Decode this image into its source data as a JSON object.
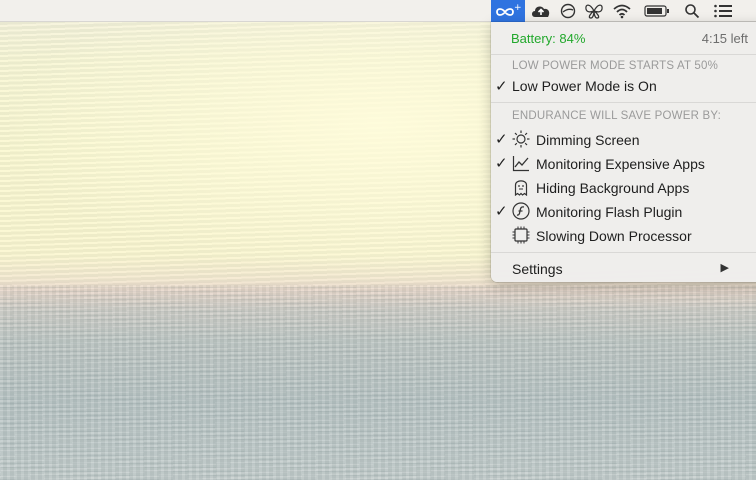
{
  "menubar": {
    "icons": [
      "endurance-icon",
      "cloud-upload-icon",
      "circle-status-icon",
      "butterfly-icon",
      "wifi-icon",
      "battery-icon",
      "spotlight-search-icon",
      "notification-list-icon"
    ]
  },
  "menu": {
    "battery_label": "Battery: 84%",
    "time_left": "4:15 left",
    "battery_color": "#22a82c",
    "low_power_header": "LOW POWER MODE STARTS AT 50%",
    "low_power_item": {
      "label": "Low Power Mode is On",
      "checked": true
    },
    "savings_header": "ENDURANCE WILL SAVE POWER BY:",
    "items": [
      {
        "label": "Dimming Screen",
        "icon": "sun-icon",
        "checked": true
      },
      {
        "label": "Monitoring Expensive Apps",
        "icon": "line-chart-icon",
        "checked": true
      },
      {
        "label": "Hiding Background Apps",
        "icon": "ghost-icon",
        "checked": false
      },
      {
        "label": "Monitoring Flash Plugin",
        "icon": "flash-plugin-icon",
        "checked": true
      },
      {
        "label": "Slowing Down Processor",
        "icon": "cpu-icon",
        "checked": false
      }
    ],
    "settings_label": "Settings",
    "check_glyph": "✓",
    "submenu_arrow": "▶"
  }
}
